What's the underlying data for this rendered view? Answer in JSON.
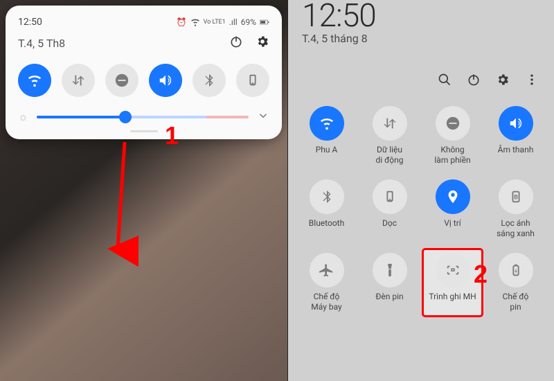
{
  "left": {
    "time": "12:50",
    "date": "T.4, 5 Th8",
    "battery": "69%",
    "status_net": "Vo LTE1",
    "alarm_icon": "⏰",
    "wifi_sig": "wifi",
    "signal": ".ıll",
    "qs": [
      {
        "name": "wifi-icon",
        "active": true
      },
      {
        "name": "data-icon",
        "active": false
      },
      {
        "name": "dnd-icon",
        "active": false
      },
      {
        "name": "sound-icon",
        "active": true
      },
      {
        "name": "bluetooth-icon",
        "active": false
      },
      {
        "name": "rotation-icon",
        "active": false
      }
    ],
    "brightness_pct": 42,
    "annotation": "1"
  },
  "right": {
    "time": "12:50",
    "date": "T.4, 5 tháng 8",
    "util": [
      "search-icon",
      "power-icon",
      "settings-icon",
      "more-icon"
    ],
    "tiles": [
      {
        "name": "wifi-tile",
        "label": "Phu A",
        "active": true
      },
      {
        "name": "mobile-data-tile",
        "label": "Dữ liệu\ndi động",
        "active": false
      },
      {
        "name": "dnd-tile",
        "label": "Không\nlàm phiền",
        "active": false
      },
      {
        "name": "sound-tile",
        "label": "Âm thanh",
        "active": true
      },
      {
        "name": "bluetooth-tile",
        "label": "Bluetooth",
        "active": false
      },
      {
        "name": "rotation-tile",
        "label": "Dọc",
        "active": false
      },
      {
        "name": "location-tile",
        "label": "Vị trí",
        "active": true
      },
      {
        "name": "bluelight-tile",
        "label": "Lọc ánh\nsáng xanh",
        "active": false
      },
      {
        "name": "airplane-tile",
        "label": "Chế độ\nMáy bay",
        "active": false
      },
      {
        "name": "flashlight-tile",
        "label": "Đèn pin",
        "active": false
      },
      {
        "name": "screen-record-tile",
        "label": "Trình ghi MH",
        "active": false,
        "highlight": true
      },
      {
        "name": "battery-tile",
        "label": "Chế độ\npin",
        "active": false
      }
    ],
    "annotation": "2"
  },
  "colors": {
    "accent": "#1976ff",
    "annot": "#ff0000"
  }
}
